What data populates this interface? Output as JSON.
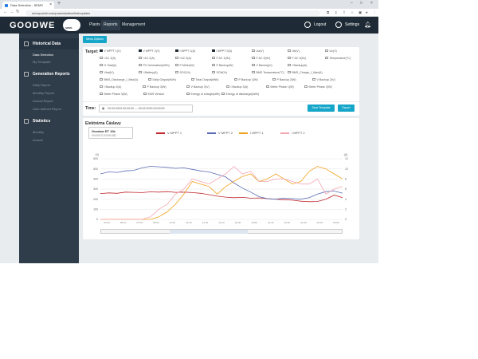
{
  "browser": {
    "tab_title": "Data Selection - SEMS",
    "url": "semsportal.com/powerstation/historydata"
  },
  "app": {
    "logo": "GOODWE",
    "cloud_label": "SEMS",
    "nav": [
      "Plants",
      "Reports",
      "Management"
    ],
    "logout": "Logout",
    "settings": "Settings"
  },
  "sidebar": {
    "groups": [
      {
        "label": "Historical Data"
      },
      {
        "label": "Generation Reports"
      },
      {
        "label": "Statistics"
      }
    ],
    "items": [
      "Data Selection",
      "My Template",
      "Daily Report",
      "Monthly Report",
      "Annual Report",
      "User-defined Report",
      "Monthly",
      "Annual"
    ]
  },
  "main": {
    "menu_options": "Menu Options",
    "target_label": "Target:",
    "time_label": "Time:",
    "date_range": "29.03.2023 00:00:00  —  30.03.2023 00:00:00",
    "save_template": "Save Template",
    "export": "Export",
    "targets": [
      {
        "label": "V MPPT 1(V)",
        "checked": true
      },
      {
        "label": "V MPPT 2(V)",
        "checked": true
      },
      {
        "label": "I MPPT 1(A)",
        "checked": true
      },
      {
        "label": "I MPPT 2(A)",
        "checked": true
      },
      {
        "label": "Ua(V)",
        "checked": false
      },
      {
        "label": "Ub(V)",
        "checked": false
      },
      {
        "label": "Uc(V)",
        "checked": false
      },
      {
        "label": "I AC 1(A)",
        "checked": false
      },
      {
        "label": "I AC 2(A)",
        "checked": false
      },
      {
        "label": "I AC 3(A)",
        "checked": false
      },
      {
        "label": "F AC 1(Hz)",
        "checked": false
      },
      {
        "label": "F AC 2(Hz)",
        "checked": false
      },
      {
        "label": "F AC 3(Hz)",
        "checked": false
      },
      {
        "label": "Temperature(°C)",
        "checked": false
      },
      {
        "label": "H Total(h)",
        "checked": false
      },
      {
        "label": "PV Generation(kWh)",
        "checked": false
      },
      {
        "label": "P Meter(W)",
        "checked": false
      },
      {
        "label": "P Backup(W)",
        "checked": false
      },
      {
        "label": "V Backup(V)",
        "checked": false
      },
      {
        "label": "I Backup(A)",
        "checked": false
      },
      {
        "label": "Vbat(V)",
        "checked": false
      },
      {
        "label": "I Battery(A)",
        "checked": false
      },
      {
        "label": "SOC(%)",
        "checked": false
      },
      {
        "label": "SOH(%)",
        "checked": false
      },
      {
        "label": "BMS Temperature(°C)",
        "checked": false
      },
      {
        "label": "BMS_Charge_I_Max(A)",
        "checked": false
      },
      {
        "label": "BMS_Discharge_I_Max(A)",
        "checked": false
      },
      {
        "label": "Daily Output(kWh)",
        "checked": false
      },
      {
        "label": "Total Output(kWh)",
        "checked": false
      },
      {
        "label": "P Backup 1(W)",
        "checked": false
      },
      {
        "label": "P Backup 2(W)",
        "checked": false
      },
      {
        "label": "V Backup 2(V)",
        "checked": false
      },
      {
        "label": "I Backup 2(A)",
        "checked": false
      },
      {
        "label": "P Backup 3(W)",
        "checked": false
      },
      {
        "label": "V Backup 3(V)",
        "checked": false
      },
      {
        "label": "I Backup 3(A)",
        "checked": false
      },
      {
        "label": "Meter Phase 1(W)",
        "checked": false
      },
      {
        "label": "Meter Phase 2(W)",
        "checked": false
      },
      {
        "label": "Meter Phase 3(W)",
        "checked": false
      },
      {
        "label": "EMS Version",
        "checked": false
      },
      {
        "label": "Energy of charge(kWh)",
        "checked": false
      },
      {
        "label": "Energy of discharge(kWh)",
        "checked": false
      }
    ]
  },
  "chart_panel": {
    "plant": "Elektrárna Čáslavy",
    "device_name": "Goodwe ET 10k",
    "device_sn": "9010KETU220W1582"
  },
  "chart_data": {
    "type": "line",
    "y_left_label": "(V)",
    "y_right_label": "(A)",
    "y_left_ticks": [
      0,
      100,
      200,
      300,
      400,
      500,
      600
    ],
    "y_right_ticks": [
      0,
      2,
      4,
      6,
      8,
      10,
      12
    ],
    "x_ticks": [
      "03:00",
      "05:10",
      "07:00",
      "08:50",
      "10:40",
      "12:30",
      "14:20",
      "16:10",
      "18:00",
      "19:50",
      "21:40",
      "23:30",
      "01:20",
      "03:10",
      "05:00"
    ],
    "series": [
      {
        "name": "V MPPT 1",
        "color": "#c0272d",
        "axis": "left",
        "values": [
          255,
          262,
          258,
          270,
          268,
          265,
          272,
          270,
          275,
          268,
          270,
          265,
          258,
          245,
          230,
          220,
          215,
          218,
          210,
          212,
          205,
          200,
          195,
          190,
          180,
          175,
          178,
          200,
          240,
          215
        ]
      },
      {
        "name": "V MPPT 2",
        "color": "#5a6bb4",
        "axis": "left",
        "values": [
          450,
          470,
          465,
          480,
          485,
          510,
          525,
          520,
          515,
          505,
          510,
          495,
          480,
          470,
          445,
          420,
          360,
          310,
          270,
          225,
          205,
          200,
          210,
          205,
          200,
          215,
          250,
          275,
          280,
          260
        ]
      },
      {
        "name": "I MPPT 1",
        "color": "#f0a11c",
        "axis": "right",
        "values": [
          0,
          0,
          0,
          0,
          0,
          0,
          0,
          0.5,
          1.5,
          3,
          5,
          7.5,
          7,
          6.5,
          5,
          6.5,
          7.5,
          8.5,
          9,
          7.5,
          8,
          9,
          8,
          7,
          7.5,
          9.5,
          10.5,
          10,
          9,
          8
        ]
      },
      {
        "name": "I MPPT 2",
        "color": "#f3a5b2",
        "axis": "right",
        "values": [
          0,
          0,
          0,
          0,
          0,
          0,
          0.5,
          2,
          3,
          5,
          6,
          8,
          7.5,
          7,
          8,
          9,
          10.5,
          9,
          9.5,
          7.5,
          7.5,
          8,
          8,
          7.5,
          7,
          7,
          8,
          5,
          6,
          6.5
        ]
      }
    ]
  }
}
